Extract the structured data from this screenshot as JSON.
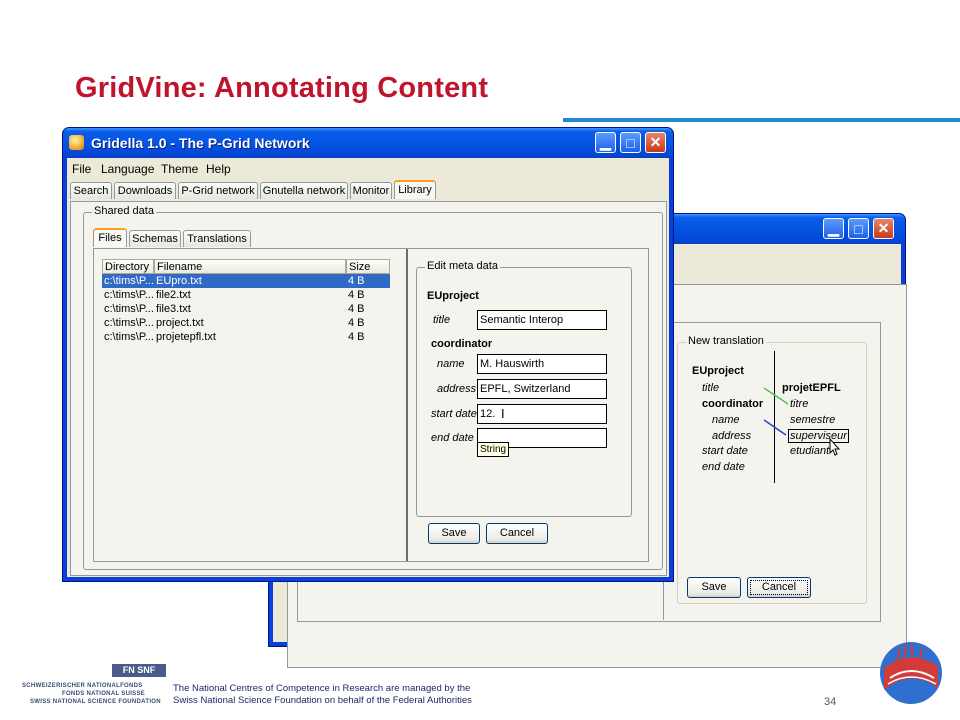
{
  "slide": {
    "title": "GridVine: Annotating Content",
    "page_number": "34",
    "footer_line1": "The National Centres of Competence in Research are managed by the",
    "footer_line2": "Swiss National Science Foundation on behalf of the Federal Authorities",
    "logo_lines": [
      "Schweizerischer Nationalfonds",
      "Fonds national suisse",
      "Swiss National Science Foundation"
    ],
    "logo_mark": "FN SNF"
  },
  "colors": {
    "title": "#c0142d",
    "rule": "#1f8ad0",
    "xp_blue": "#0a3fd8",
    "selection": "#316ac5",
    "link_green": "#4fc34f",
    "link_blue": "#2a44c8"
  },
  "window_back": {
    "group_label": "New translation",
    "source_root": "EUproject",
    "source_fields": [
      "title",
      "coordinator",
      "name",
      "address",
      "start date",
      "end date"
    ],
    "target_root": "projetEPFL",
    "target_fields": [
      "titre",
      "semestre",
      "superviseur",
      "etudiant"
    ],
    "save_label": "Save",
    "cancel_label": "Cancel"
  },
  "window_front": {
    "title": "Gridella 1.0 - The P-Grid Network",
    "menu": [
      "File",
      "Language",
      "Theme",
      "Help"
    ],
    "tabs": [
      "Search",
      "Downloads",
      "P-Grid network",
      "Gnutella network",
      "Monitor",
      "Library"
    ],
    "active_tab": "Library",
    "shared_label": "Shared data",
    "subtabs": [
      "Files",
      "Schemas",
      "Translations"
    ],
    "active_subtab": "Files",
    "table": {
      "headers": [
        "Directory",
        "Filename",
        "Size"
      ],
      "rows": [
        [
          "c:\\tims\\P...",
          "EUpro.txt",
          "4 B"
        ],
        [
          "c:\\tims\\P...",
          "file2.txt",
          "4 B"
        ],
        [
          "c:\\tims\\P...",
          "file3.txt",
          "4 B"
        ],
        [
          "c:\\tims\\P...",
          "project.txt",
          "4 B"
        ],
        [
          "c:\\tims\\P...",
          "projetepfl.txt",
          "4 B"
        ]
      ]
    },
    "meta": {
      "group_label": "Edit meta data",
      "root": "EUproject",
      "title_label": "title",
      "title_value": "Semantic Interop",
      "coordinator_label": "coordinator",
      "name_label": "name",
      "name_value": "M. Hauswirth",
      "address_label": "address",
      "address_value": "EPFL, Switzerland",
      "start_label": "start date",
      "start_value": "12.",
      "end_label": "end date",
      "end_value": "",
      "tooltip": "String",
      "save_label": "Save",
      "cancel_label": "Cancel"
    }
  }
}
